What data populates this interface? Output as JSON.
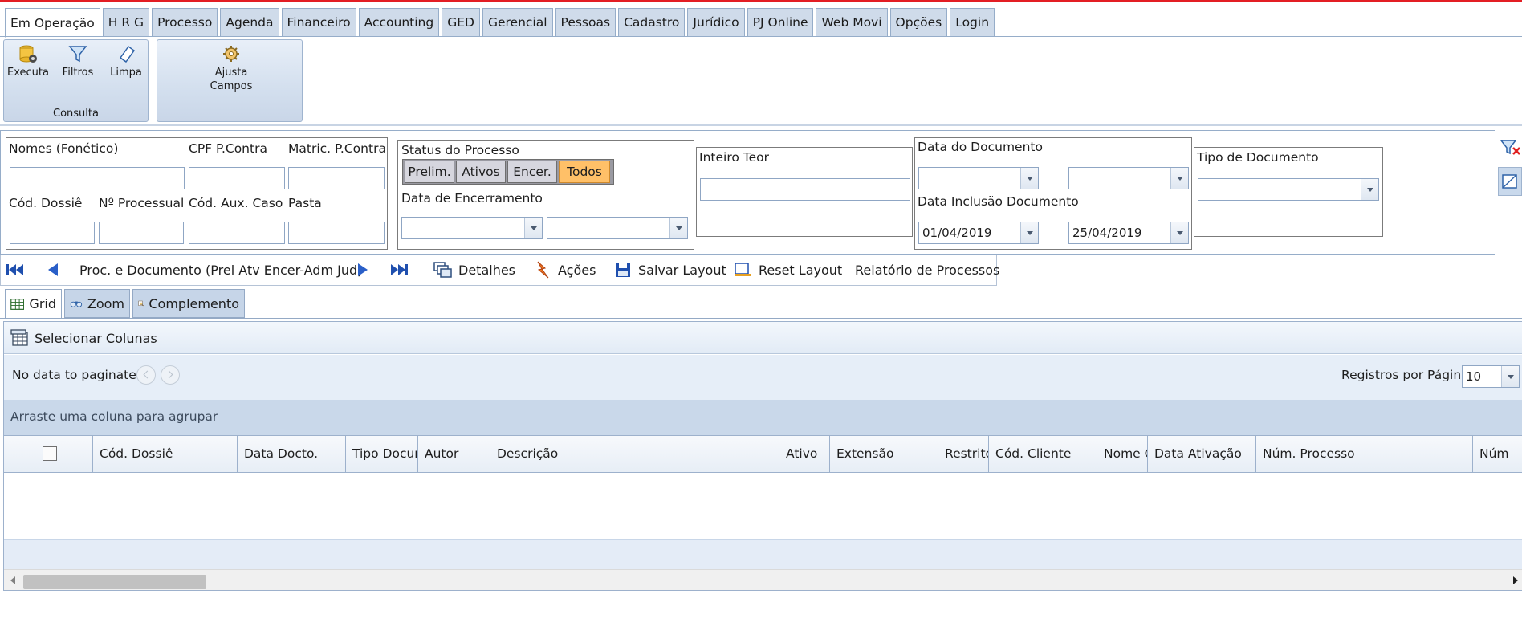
{
  "menu": {
    "tabs": [
      {
        "label": "Em Operação",
        "active": true
      },
      {
        "label": "H R G"
      },
      {
        "label": "Processo"
      },
      {
        "label": "Agenda"
      },
      {
        "label": "Financeiro"
      },
      {
        "label": "Accounting"
      },
      {
        "label": "GED"
      },
      {
        "label": "Gerencial"
      },
      {
        "label": "Pessoas"
      },
      {
        "label": "Cadastro"
      },
      {
        "label": "Jurídico"
      },
      {
        "label": "PJ Online"
      },
      {
        "label": "Web Movi"
      },
      {
        "label": "Opções"
      },
      {
        "label": "Login"
      }
    ]
  },
  "ribbon": {
    "consulta": {
      "caption": "Consulta",
      "executa": "Executa",
      "filtros": "Filtros",
      "limpa": "Limpa"
    },
    "ajusta": {
      "line1": "Ajusta",
      "line2": "Campos"
    }
  },
  "filters": {
    "nomes_label": "Nomes (Fonético)",
    "cpf_label": "CPF P.Contra",
    "matric_label": "Matric. P.Contra",
    "cod_dossie_label": "Cód. Dossiê",
    "n_processual_label": "Nº Processual",
    "cod_aux_label": "Cód. Aux. Caso",
    "pasta_label": "Pasta",
    "status_label": "Status do Processo",
    "status_options": [
      "Prelim.",
      "Ativos",
      "Encer.",
      "Todos"
    ],
    "status_selected": "Todos",
    "encerramento_label": "Data de Encerramento",
    "inteiro_teor_label": "Inteiro Teor",
    "data_documento_label": "Data do Documento",
    "data_inclusao_label": "Data Inclusão Documento",
    "data_inclusao_from": "01/04/2019",
    "data_inclusao_to": "25/04/2019",
    "tipo_documento_label": "Tipo de Documento"
  },
  "toolbar": {
    "title": "Proc. e Documento (Prel Atv Encer-Adm Jud)",
    "detalhes": "Detalhes",
    "acoes": "Ações",
    "salvar_layout": "Salvar Layout",
    "reset_layout": "Reset Layout",
    "relatorio": "Relatório de Processos"
  },
  "view_tabs": {
    "grid": "Grid",
    "zoom": "Zoom",
    "complemento": "Complemento"
  },
  "grid": {
    "select_columns": "Selecionar Colunas",
    "no_data": "No data to paginate",
    "per_page_label": "Registros por Página",
    "per_page_value": "10",
    "group_hint": "Arraste uma coluna para agrupar",
    "columns": [
      "Cód. Dossiê",
      "Data Docto.",
      "Tipo Documento",
      "Autor",
      "Descrição",
      "Ativo",
      "Extensão",
      "Restrito",
      "Cód. Cliente",
      "Nome Cliente",
      "Data Ativação",
      "Núm. Processo",
      "Núm"
    ]
  },
  "colors": {
    "accent_selected": "#ffc068",
    "tab_bg": "#cfdbea",
    "border": "#96adc9",
    "top_line": "#e31e24"
  }
}
